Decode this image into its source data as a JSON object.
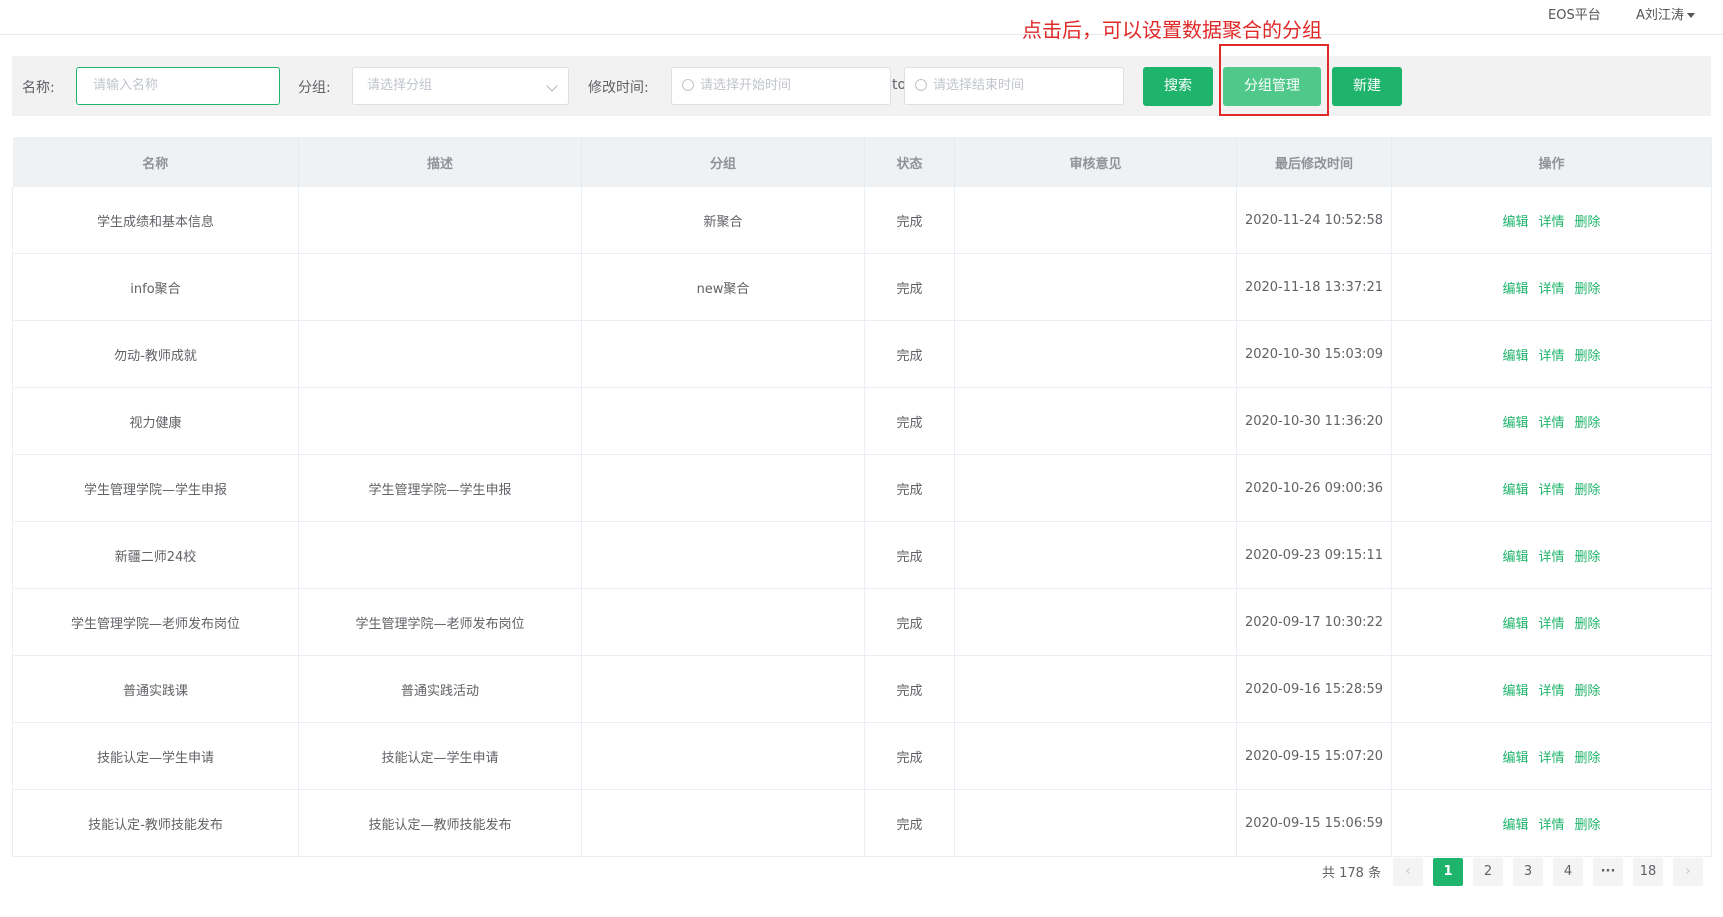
{
  "header": {
    "platform": "EOS平台",
    "user": "A刘江涛"
  },
  "annotation": "点击后，可以设置数据聚合的分组",
  "filters": {
    "name_label": "名称:",
    "name_placeholder": "请输入名称",
    "group_label": "分组:",
    "group_placeholder": "请选择分组",
    "time_label": "修改时间:",
    "start_placeholder": "请选择开始时间",
    "to": "to",
    "end_placeholder": "请选择结束时间",
    "search": "搜索",
    "group_manage": "分组管理",
    "create": "新建"
  },
  "table": {
    "columns": [
      "名称",
      "描述",
      "分组",
      "状态",
      "审核意见",
      "最后修改时间",
      "操作"
    ],
    "actions": [
      "编辑",
      "详情",
      "删除"
    ],
    "rows": [
      {
        "name": "学生成绩和基本信息",
        "desc": "",
        "group": "新聚合",
        "status": "完成",
        "review": "",
        "time": "2020-11-24 10:52:58"
      },
      {
        "name": "info聚合",
        "desc": "",
        "group": "new聚合",
        "status": "完成",
        "review": "",
        "time": "2020-11-18 13:37:21"
      },
      {
        "name": "勿动-教师成就",
        "desc": "",
        "group": "",
        "status": "完成",
        "review": "",
        "time": "2020-10-30 15:03:09"
      },
      {
        "name": "视力健康",
        "desc": "",
        "group": "",
        "status": "完成",
        "review": "",
        "time": "2020-10-30 11:36:20"
      },
      {
        "name": "学生管理学院—学生申报",
        "desc": "学生管理学院—学生申报",
        "group": "",
        "status": "完成",
        "review": "",
        "time": "2020-10-26 09:00:36"
      },
      {
        "name": "新疆二师24校",
        "desc": "",
        "group": "",
        "status": "完成",
        "review": "",
        "time": "2020-09-23 09:15:11"
      },
      {
        "name": "学生管理学院—老师发布岗位",
        "desc": "学生管理学院—老师发布岗位",
        "group": "",
        "status": "完成",
        "review": "",
        "time": "2020-09-17 10:30:22"
      },
      {
        "name": "普通实践课",
        "desc": "普通实践活动",
        "group": "",
        "status": "完成",
        "review": "",
        "time": "2020-09-16 15:28:59"
      },
      {
        "name": "技能认定—学生申请",
        "desc": "技能认定—学生申请",
        "group": "",
        "status": "完成",
        "review": "",
        "time": "2020-09-15 15:07:20"
      },
      {
        "name": "技能认定-教师技能发布",
        "desc": "技能认定—教师技能发布",
        "group": "",
        "status": "完成",
        "review": "",
        "time": "2020-09-15 15:06:59"
      }
    ]
  },
  "pagination": {
    "total": "共 178 条",
    "prev": "‹",
    "pages": [
      "1",
      "2",
      "3",
      "4",
      "···",
      "18"
    ],
    "next": "›"
  }
}
